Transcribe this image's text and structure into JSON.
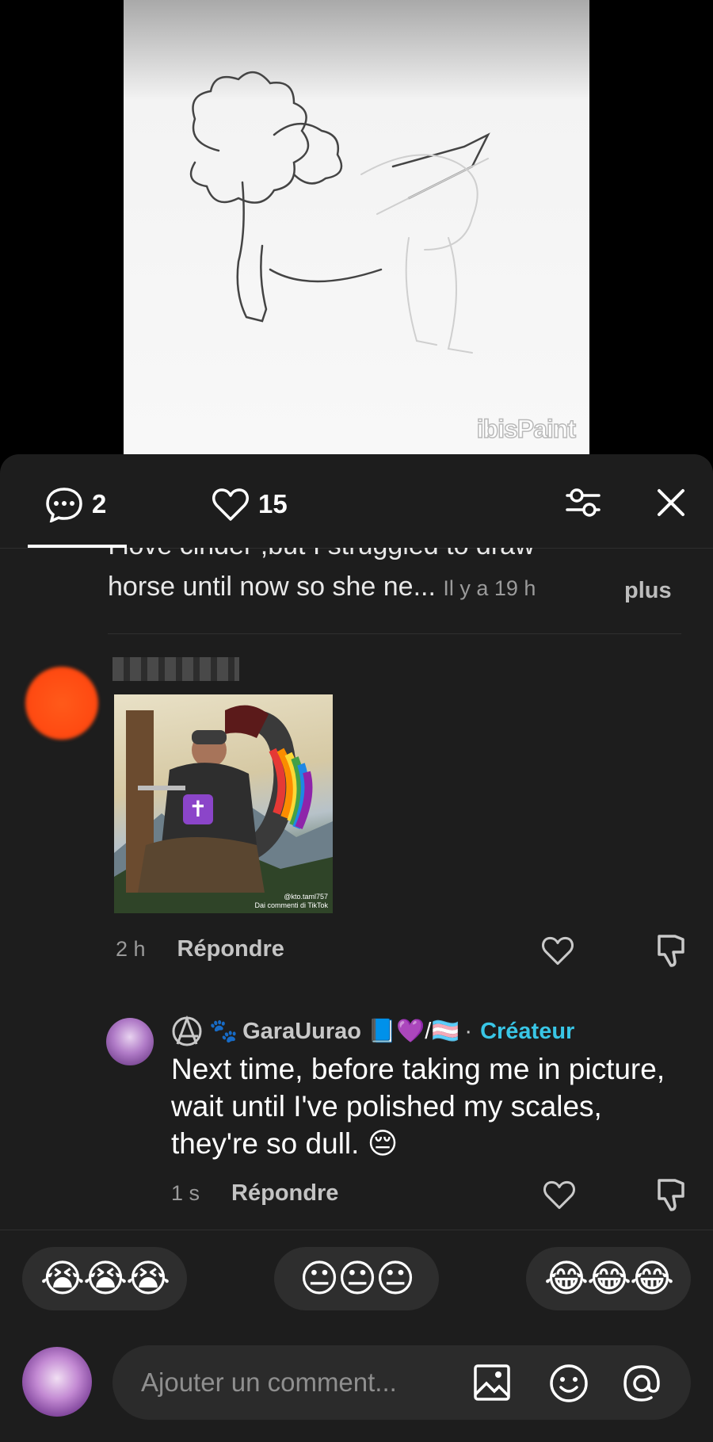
{
  "video": {
    "watermark": "ibisPaint"
  },
  "topbar": {
    "comment_count": "2",
    "like_count": "15"
  },
  "previous_comment": {
    "line1_cut": "I love cinder ,but I struggled to draw",
    "line2": "horse until now so she ne...",
    "time": "Il y a 19 h",
    "more": "plus"
  },
  "comment": {
    "image_credit_line1": "@kto.taml757",
    "image_credit_line2": "Dai commenti di TikTok",
    "time": "2 h",
    "reply_label": "Répondre"
  },
  "reply": {
    "name": "GaraUurao",
    "name_emojis": "📘💜/🏳️‍⚧️",
    "separator": "·",
    "creator_label": "Créateur",
    "text": "Next time, before taking me in picture, wait until I've polished my scales, they're so dull. 😔",
    "time": "1 s",
    "reply_label": "Répondre"
  },
  "reactions": [
    "😭😭😭",
    "😐😐😐",
    "😂😂😂"
  ],
  "input": {
    "placeholder": "Ajouter un comment..."
  }
}
